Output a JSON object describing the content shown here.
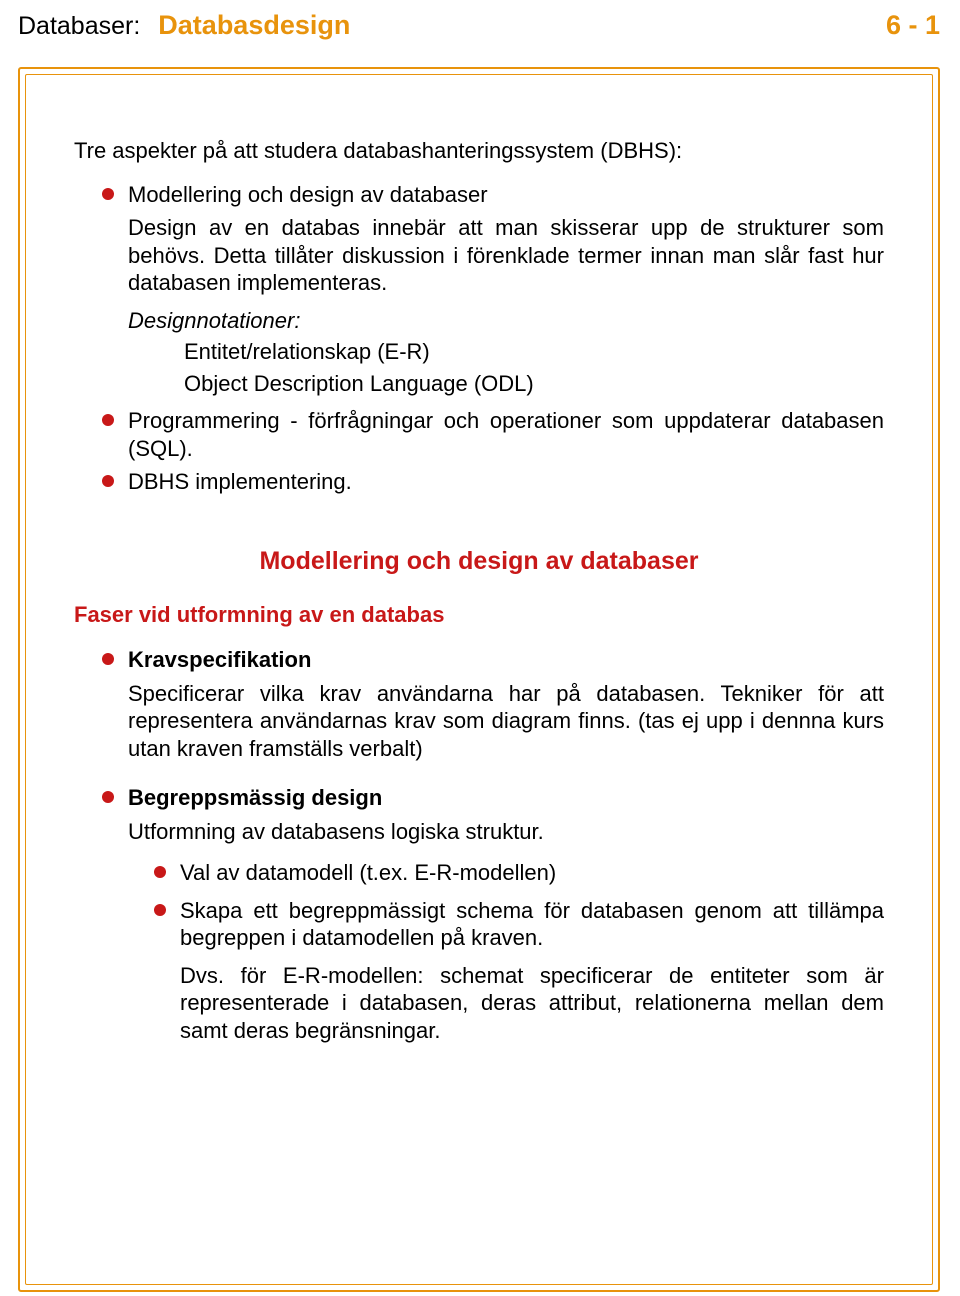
{
  "header": {
    "prefix": "Databaser:",
    "title": "Databasdesign",
    "page": "6 - 1"
  },
  "intro": "Tre aspekter på att studera databashanteringssystem (DBHS):",
  "aspects": {
    "a1": {
      "title": "Modellering och design av databaser",
      "p1": "Design av en databas innebär att man skisserar upp de strukturer som behövs. Detta tillåter diskussion i förenklade termer innan man slår fast hur databasen implementeras.",
      "p2label": "Designnotationer:",
      "not1": "Entitet/relationskap (E-R)",
      "not2": "Object Description Language (ODL)"
    },
    "a2": "Programmering - förfrågningar och operationer som uppdaterar databasen (SQL).",
    "a3": "DBHS implementering."
  },
  "section_heading": "Modellering och design av databaser",
  "faser_heading": "Faser vid utformning av en databas",
  "faser": {
    "f1": {
      "label": "Kravspecifikation",
      "body": "Specificerar vilka krav användarna har på databasen. Tekniker för att representera användarnas krav som diagram finns. (tas ej upp i dennna kurs utan kraven framställs verbalt)"
    },
    "f2": {
      "label": "Begreppsmässig design",
      "body": "Utformning av databasens logiska struktur.",
      "n1": "Val av datamodell (t.ex. E-R-modellen)",
      "n2": "Skapa ett begreppmässigt schema för databasen genom att tillämpa begreppen i datamodellen på kraven.",
      "n2b": "Dvs. för E-R-modellen: schemat specificerar de entiteter som är representerade i databasen, deras attribut, relationerna mellan dem samt deras begränsningar."
    }
  }
}
